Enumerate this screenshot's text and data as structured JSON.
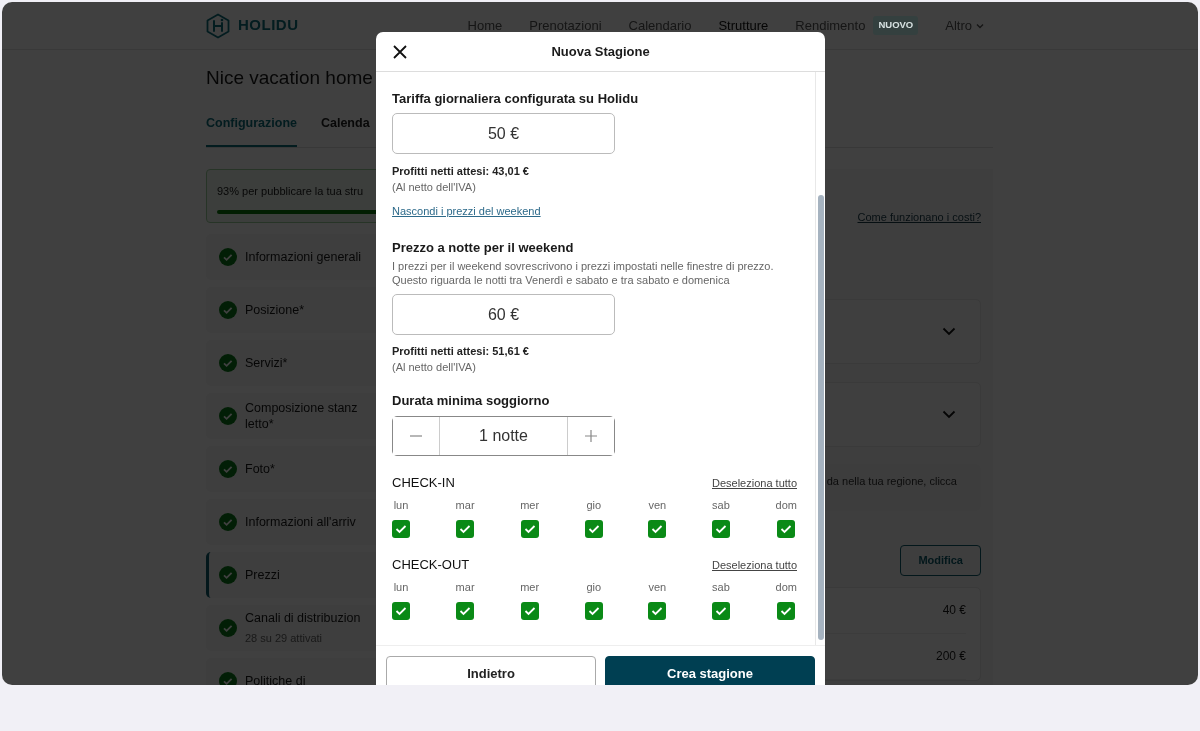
{
  "navbar": {
    "logo": "HOLIDU",
    "items": [
      {
        "label": "Home",
        "selected": false,
        "dropdown": false
      },
      {
        "label": "Prenotazioni",
        "selected": false,
        "dropdown": false
      },
      {
        "label": "Calendario",
        "selected": false,
        "dropdown": false
      },
      {
        "label": "Strutture",
        "selected": true,
        "dropdown": false
      },
      {
        "label": "Rendimento",
        "selected": false,
        "dropdown": false,
        "badge": "NUOVO"
      },
      {
        "label": "Altro",
        "selected": false,
        "dropdown": true
      }
    ]
  },
  "page": {
    "title": "Nice vacation home",
    "tabs": [
      {
        "label": "Configurazione",
        "selected": true
      },
      {
        "label": "Calenda",
        "selected": false
      }
    ],
    "progress": {
      "text": "93% per pubblicare la tua stru",
      "level": 0.93
    },
    "sections": [
      {
        "label": "Informazioni generali",
        "completed": true,
        "selected": false
      },
      {
        "label": "Posizione*",
        "completed": true,
        "selected": false
      },
      {
        "label": "Servizi*",
        "completed": true,
        "selected": false
      },
      {
        "label": "Composizione stanz letto*",
        "completed": true,
        "selected": false
      },
      {
        "label": "Foto*",
        "completed": true,
        "selected": false
      },
      {
        "label": "Informazioni all'arriv",
        "completed": true,
        "selected": false
      },
      {
        "label": "Prezzi",
        "completed": true,
        "selected": true
      },
      {
        "label": "Canali di distribuzion",
        "sublabel": "28 su 29 attivati",
        "completed": true,
        "selected": false
      },
      {
        "label": "Politiche di",
        "completed": true,
        "selected": false
      }
    ],
    "costs_link": "Come funzionano i costi?",
    "collapsible_cards": [
      {
        "expanded": false
      },
      {
        "expanded": false
      }
    ],
    "info_note": {
      "text": "da nella tua regione,",
      "link": "clicca"
    },
    "edit_button": "Modifica",
    "price_rows": [
      {
        "value": "40 €"
      },
      {
        "value": "200 €"
      }
    ]
  },
  "modal": {
    "title": "Nuova Stagione",
    "daily_rate": {
      "label": "Tariffa giornaliera configurata su Holidu",
      "value": "50 €",
      "profit": "Profitti netti attesi: 43,01 €",
      "note": "(Al netto dell'IVA)"
    },
    "weekend_link": "Nascondi i prezzi del weekend",
    "weekend_rate": {
      "label": "Prezzo a notte per il weekend",
      "description": "I prezzi per il weekend sovrescrivono i prezzi impostati nelle finestre di prezzo. Questo riguarda le notti tra Venerdì e sabato e tra sabato e domenica",
      "value": "60 €",
      "profit": "Profitti netti attesi: 51,61 €",
      "note": "(Al netto dell'IVA)"
    },
    "min_stay": {
      "label": "Durata minima soggiorno",
      "value": "1 notte"
    },
    "day_groups": [
      {
        "title": "CHECK-IN",
        "deselect": "Deseleziona tutto",
        "days": [
          {
            "label": "lun",
            "checked": true
          },
          {
            "label": "mar",
            "checked": true
          },
          {
            "label": "mer",
            "checked": true
          },
          {
            "label": "gio",
            "checked": true
          },
          {
            "label": "ven",
            "checked": true
          },
          {
            "label": "sab",
            "checked": true
          },
          {
            "label": "dom",
            "checked": true
          }
        ]
      },
      {
        "title": "CHECK-OUT",
        "deselect": "Deseleziona tutto",
        "days": [
          {
            "label": "lun",
            "checked": true
          },
          {
            "label": "mar",
            "checked": true
          },
          {
            "label": "mer",
            "checked": true
          },
          {
            "label": "gio",
            "checked": true
          },
          {
            "label": "ven",
            "checked": true
          },
          {
            "label": "sab",
            "checked": true
          },
          {
            "label": "dom",
            "checked": true
          }
        ]
      }
    ],
    "buttons": [
      {
        "label": "Indietro",
        "kind": "secondary"
      },
      {
        "label": "Crea stagione",
        "kind": "primary"
      }
    ]
  }
}
